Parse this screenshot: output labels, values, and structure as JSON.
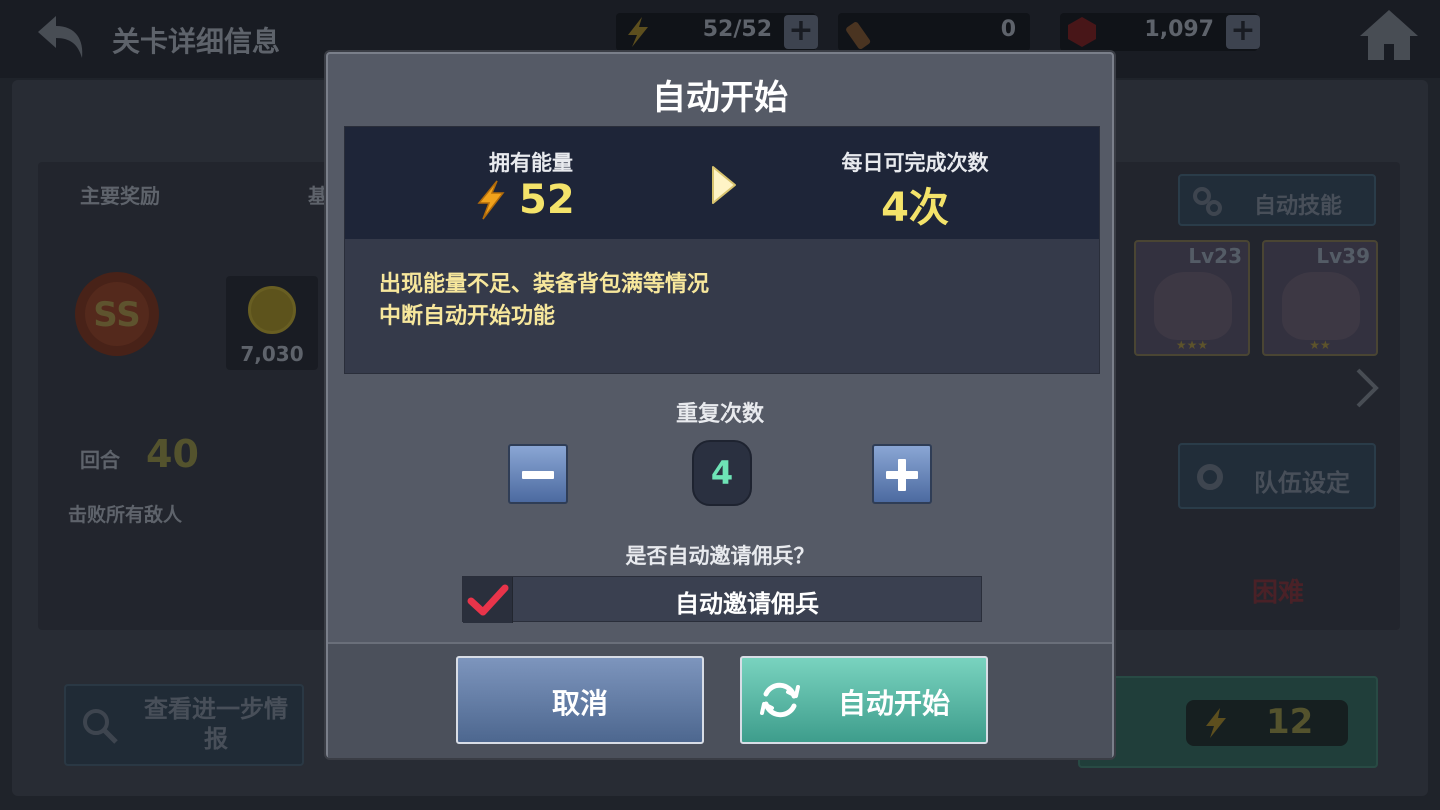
{
  "header": {
    "title": "关卡详细信息",
    "energy": "52/52",
    "tickets": "0",
    "gems": "1,097"
  },
  "stage": {
    "main_reward_label": "主要奖励",
    "base_label_fragment": "基",
    "rank_badge": "SS",
    "coin_amount": "7,030",
    "round_label": "回合",
    "round_value": "40",
    "objective": "击败所有敌人",
    "auto_skill_label": "自动技能",
    "team_setup_label": "队伍设定",
    "difficulty": "困难",
    "more_info_label": "查看进一步情报",
    "start_cost": "12",
    "heroes": [
      {
        "level": "Lv23",
        "stars": "★★★"
      },
      {
        "level": "Lv39",
        "stars": "★★"
      }
    ]
  },
  "modal": {
    "title": "自动开始",
    "energy_label": "拥有能量",
    "energy_value": "52",
    "daily_label": "每日可完成次数",
    "daily_value": "4次",
    "notice_line1": "出现能量不足、装备背包满等情况",
    "notice_line2": "中断自动开始功能",
    "repeat_label": "重复次数",
    "repeat_count": "4",
    "invite_question": "是否自动邀请佣兵？",
    "invite_label": "自动邀请佣兵",
    "invite_checked": true,
    "cancel_label": "取消",
    "start_label": "自动开始"
  },
  "colors": {
    "accent_yellow": "#f4e36a",
    "count_green": "#6ee3b6",
    "start_teal": "#3e9d8c",
    "cancel_blue": "#4d678f"
  }
}
